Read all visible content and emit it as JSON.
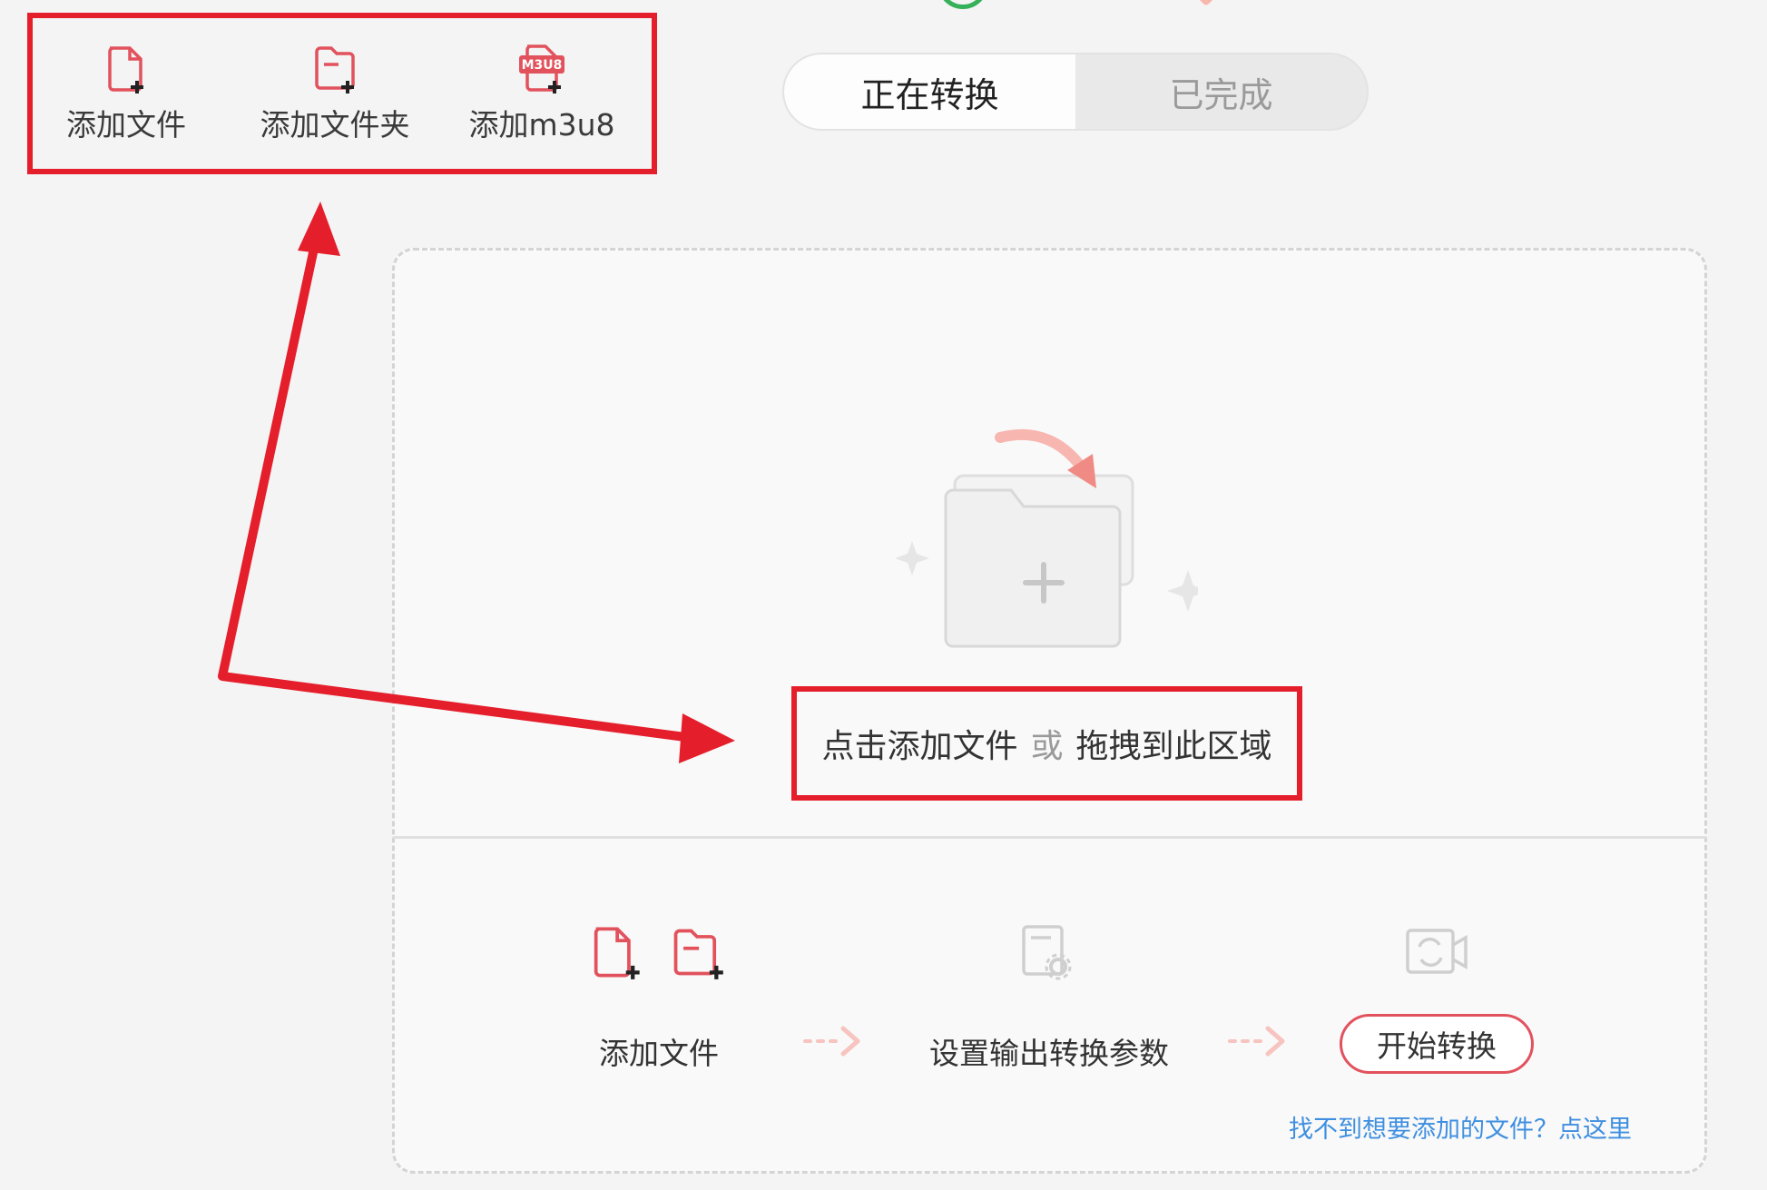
{
  "toolbar": {
    "add_file": "添加文件",
    "add_folder": "添加文件夹",
    "add_m3u8": "添加m3u8",
    "m3u8_badge": "M3U8"
  },
  "tabs": {
    "converting": "正在转换",
    "completed": "已完成"
  },
  "drop_area": {
    "hint_part1": "点击添加文件",
    "hint_or": "或",
    "hint_part2": "拖拽到此区域"
  },
  "steps": {
    "add_file": "添加文件",
    "set_params": "设置输出转换参数",
    "start": "开始转换"
  },
  "help_link": "找不到想要添加的文件？点这里",
  "colors": {
    "accent_red": "#e2525d",
    "annotation_red": "#e51e2b",
    "link_blue": "#3f8fe0"
  }
}
